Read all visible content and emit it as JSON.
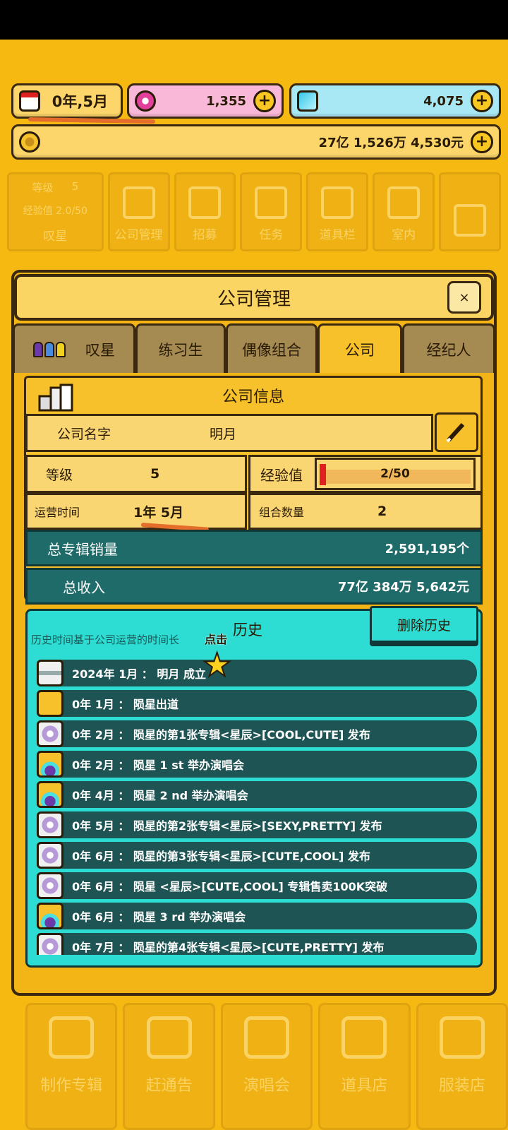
{
  "resources": {
    "date": "0年,5月",
    "gems": "1,355",
    "diamonds": "4,075",
    "money": "27亿 1,526万 4,530元"
  },
  "top_nav": {
    "player_level_label": "等级",
    "player_level": "5",
    "player_exp": "经验值 2.0/50",
    "player_name": "叹星",
    "items": [
      "公司管理",
      "招募",
      "任务",
      "道具栏",
      "室内"
    ]
  },
  "panel": {
    "title": "公司管理",
    "close_label": "×",
    "tabs": [
      "叹星",
      "练习生",
      "偶像组合",
      "公司",
      "经纪人"
    ],
    "active_tab": "公司"
  },
  "company": {
    "header": "公司信息",
    "name_label": "公司名字",
    "name_value": "明月",
    "level_label": "等级",
    "level_value": "5",
    "exp_label": "经验值",
    "exp_value": "2/50",
    "exp_progress": 0.04,
    "time_label": "运营时间",
    "time_value": "1年 5月",
    "groups_label": "组合数量",
    "groups_value": "2",
    "albums_label": "总专辑销量",
    "albums_value": "2,591,195个",
    "income_label": "总收入",
    "income_value": "77亿 384万 5,642元"
  },
  "history": {
    "title": "历史",
    "hint": "历史时间基于公司运营的时间长",
    "clear_label": "删除历史",
    "tap_label": "点击",
    "items": [
      {
        "icon": "building-icon",
        "text": "2024年 1月 ： 明月 成立"
      },
      {
        "icon": "debut-icon",
        "text": "0年 1月 ： 陨星出道"
      },
      {
        "icon": "album-icon",
        "text": "0年 2月 ： 陨星的第1张专辑<星辰>[COOL,CUTE] 发布"
      },
      {
        "icon": "concert-icon",
        "text": "0年 2月 ： 陨星  1 st 举办演唱会"
      },
      {
        "icon": "concert-icon",
        "text": "0年 4月 ： 陨星  2 nd 举办演唱会"
      },
      {
        "icon": "album-icon",
        "text": "0年 5月 ： 陨星的第2张专辑<星辰>[SEXY,PRETTY] 发布"
      },
      {
        "icon": "album-icon",
        "text": "0年 6月 ： 陨星的第3张专辑<星辰>[CUTE,COOL] 发布"
      },
      {
        "icon": "album-icon",
        "text": "0年 6月 ： 陨星 <星辰>[CUTE,COOL] 专辑售卖100K突破"
      },
      {
        "icon": "concert-icon",
        "text": "0年 6月 ： 陨星  3 rd 举办演唱会"
      },
      {
        "icon": "album-icon",
        "text": "0年 7月 ： 陨星的第4张专辑<星辰>[CUTE,PRETTY] 发布"
      }
    ]
  },
  "bottom_nav": [
    "制作专辑",
    "赶通告",
    "演唱会",
    "道具店",
    "服装店"
  ]
}
